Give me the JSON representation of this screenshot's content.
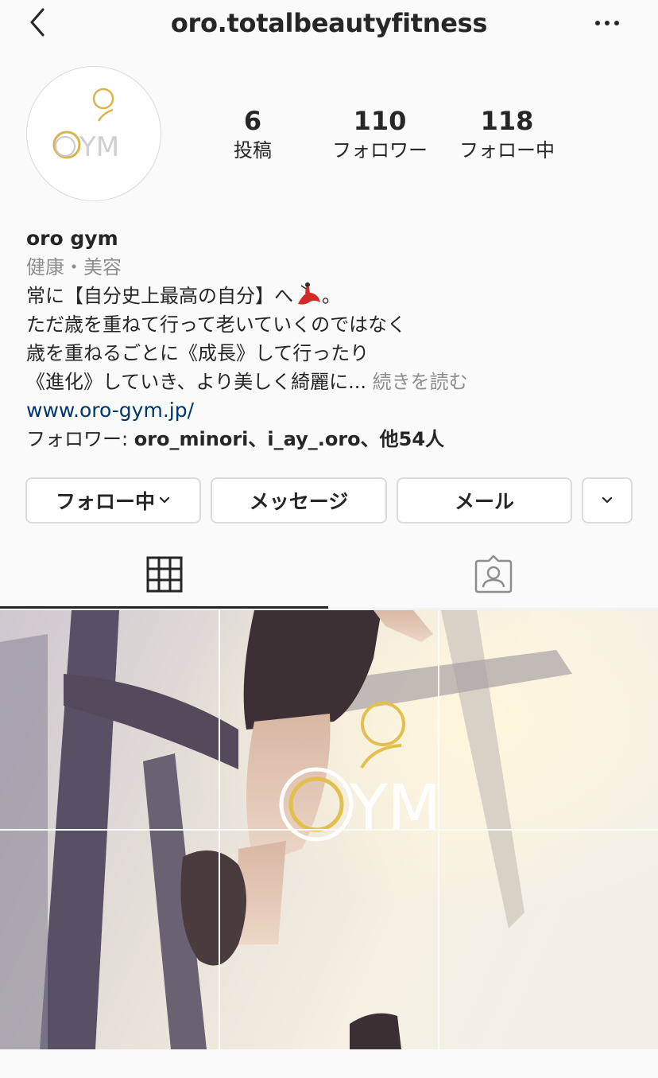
{
  "header": {
    "username": "oro.totalbeautyfitness",
    "back_icon": "chevron-left-icon",
    "more_icon": "more-horizontal-icon"
  },
  "profile": {
    "avatar_logo_text": "ORO GYM",
    "stats": [
      {
        "value": "6",
        "label": "投稿"
      },
      {
        "value": "110",
        "label": "フォロワー"
      },
      {
        "value": "118",
        "label": "フォロー中"
      }
    ]
  },
  "bio": {
    "name": "oro gym",
    "category": "健康・美容",
    "lines": [
      "常に【自分史上最高の自分】へ",
      "。",
      "ただ歳を重ねて行って老いていくのではなく",
      "歳を重ねるごとに《成長》して行ったり",
      "《進化》していき、より美しく綺麗に..."
    ],
    "more_label": "続きを読む",
    "url": "www.oro-gym.jp/",
    "followers_prefix": "フォロワー: ",
    "followers_names": "oro_minori、i_ay_.oro、他54人"
  },
  "actions": {
    "following_label": "フォロー中",
    "message_label": "メッセージ",
    "email_label": "メール"
  },
  "tabs": {
    "grid_icon": "grid-icon",
    "tagged_icon": "tagged-person-icon"
  },
  "colors": {
    "link": "#00376b",
    "muted": "#8e8e8e",
    "gold": "#d9b44a"
  }
}
